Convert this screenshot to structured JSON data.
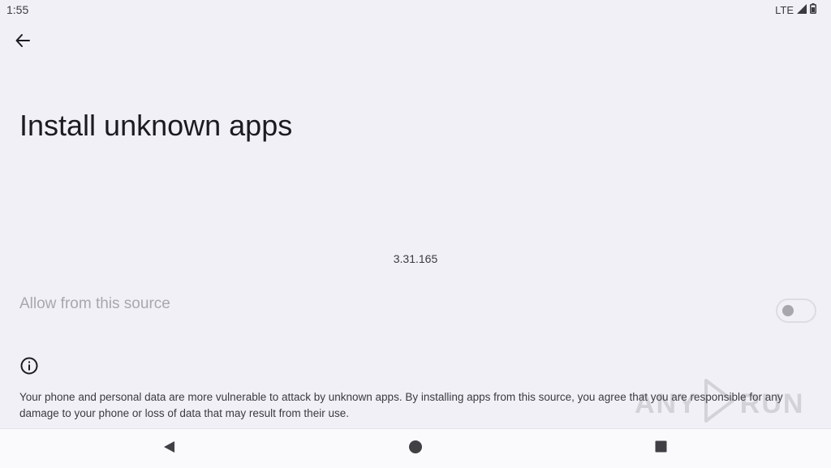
{
  "status_bar": {
    "time": "1:55",
    "network": "LTE",
    "icons": [
      "signal-icon",
      "battery-icon"
    ]
  },
  "header": {
    "back_icon": "arrow-left-icon",
    "title": "Install unknown apps"
  },
  "app": {
    "version": "3.31.165"
  },
  "allow_setting": {
    "label": "Allow from this source",
    "enabled": false
  },
  "info": {
    "icon": "info-icon",
    "text": "Your phone and personal data are more vulnerable to attack by unknown apps. By installing apps from this source, you agree that you are responsible for any damage to your phone or loss of data that may result from their use."
  },
  "watermark": {
    "left": "ANY",
    "right": "RUN"
  },
  "nav_bar": {
    "buttons": [
      "back-triangle-icon",
      "home-circle-icon",
      "recents-square-icon"
    ]
  },
  "colors": {
    "background": "#f1f0f7",
    "text_primary": "#1c1b20",
    "text_disabled": "#a8a7ad",
    "navbar": "#fafafd"
  }
}
